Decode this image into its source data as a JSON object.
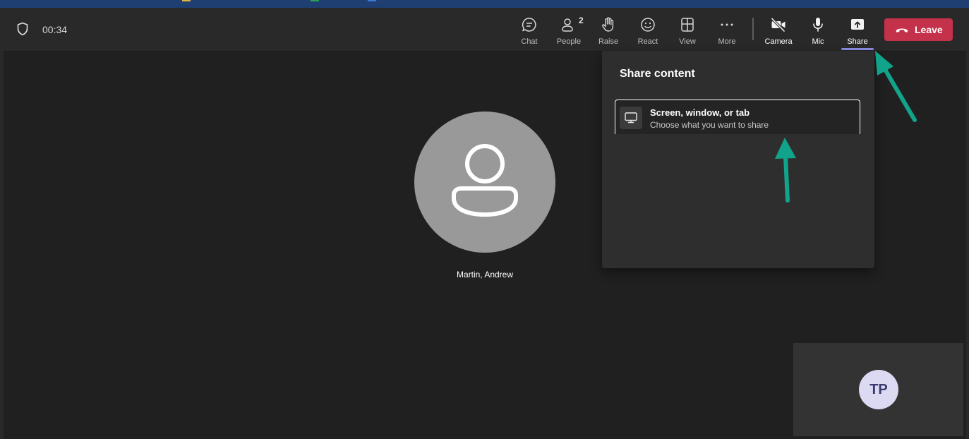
{
  "meeting": {
    "timer": "00:34"
  },
  "toolbar": {
    "chat_label": "Chat",
    "people_label": "People",
    "people_count": "2",
    "raise_label": "Raise",
    "react_label": "React",
    "view_label": "View",
    "more_label": "More",
    "camera_label": "Camera",
    "mic_label": "Mic",
    "share_label": "Share",
    "leave_label": "Leave"
  },
  "participant": {
    "name": "Martin, Andrew"
  },
  "share_panel": {
    "title": "Share content",
    "option_title": "Screen, window, or tab",
    "option_subtitle": "Choose what you want to share"
  },
  "self_view": {
    "initials": "TP"
  },
  "colors": {
    "leave": "#c4314b",
    "share_active": "#8c8fe8",
    "annotation_arrow": "#12a48a",
    "self_avatar_bg": "#dcdaf2",
    "avatar_bg": "#999999"
  }
}
